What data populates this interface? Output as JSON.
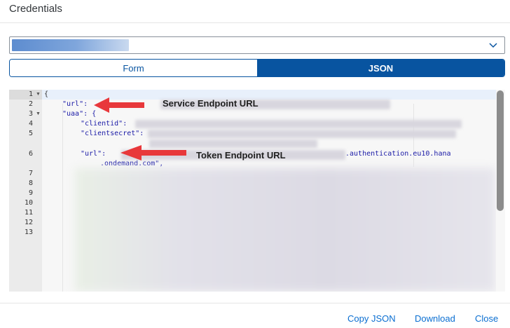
{
  "dialog": {
    "title": "Credentials"
  },
  "service_key_select": {
    "value": "",
    "icon": "chevron-down-icon"
  },
  "tabs": {
    "form_label": "Form",
    "json_label": "JSON",
    "selected": "JSON"
  },
  "editor": {
    "line_numbers": [
      "1",
      "2",
      "3",
      "4",
      "5",
      "6",
      "7",
      "8",
      "9",
      "10",
      "11",
      "12",
      "13"
    ],
    "lines": {
      "l1": "{",
      "l2": "\"url\":",
      "l3": "\"uaa\": {",
      "l4": "\"clientid\":",
      "l5": "\"clientsecret\":",
      "l6_key": "\"url\":",
      "l6_value": ".authentication.eu10.hana",
      "l6_cont": ".ondemand.com\","
    }
  },
  "annotations": {
    "service_endpoint": "Service Endpoint URL",
    "token_endpoint": "Token Endpoint URL",
    "arrow_color": "#e8383b"
  },
  "footer": {
    "copy_json": "Copy JSON",
    "download": "Download",
    "close": "Close"
  },
  "colors": {
    "accent": "#0854a0",
    "link": "#0a6ed1"
  }
}
